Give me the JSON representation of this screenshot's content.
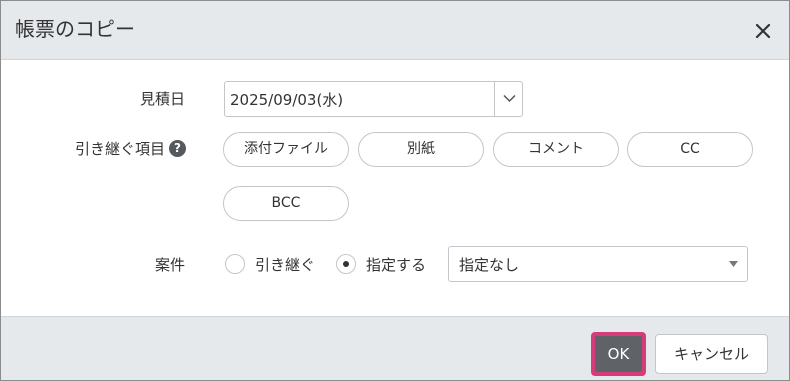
{
  "dialog": {
    "title": "帳票のコピー",
    "close_icon": "close-icon"
  },
  "form": {
    "date": {
      "label": "見積日",
      "value": "2025/09/03(水)",
      "dropdown_icon": "chevron-down-icon"
    },
    "carry_over": {
      "label": "引き継ぐ項目",
      "help_icon": "question-circle-icon",
      "help_glyph": "?",
      "items": [
        "添付ファイル",
        "別紙",
        "コメント",
        "CC",
        "BCC"
      ]
    },
    "project": {
      "label": "案件",
      "options": [
        {
          "label": "引き継ぐ",
          "selected": false
        },
        {
          "label": "指定する",
          "selected": true
        }
      ],
      "select_value": "指定なし",
      "select_icon": "caret-down-icon"
    }
  },
  "footer": {
    "ok_label": "OK",
    "cancel_label": "キャンセル"
  },
  "colors": {
    "header_bg": "#e6e9ec",
    "ok_bg": "#5f6368",
    "focus_ring": "#d63b7a"
  }
}
